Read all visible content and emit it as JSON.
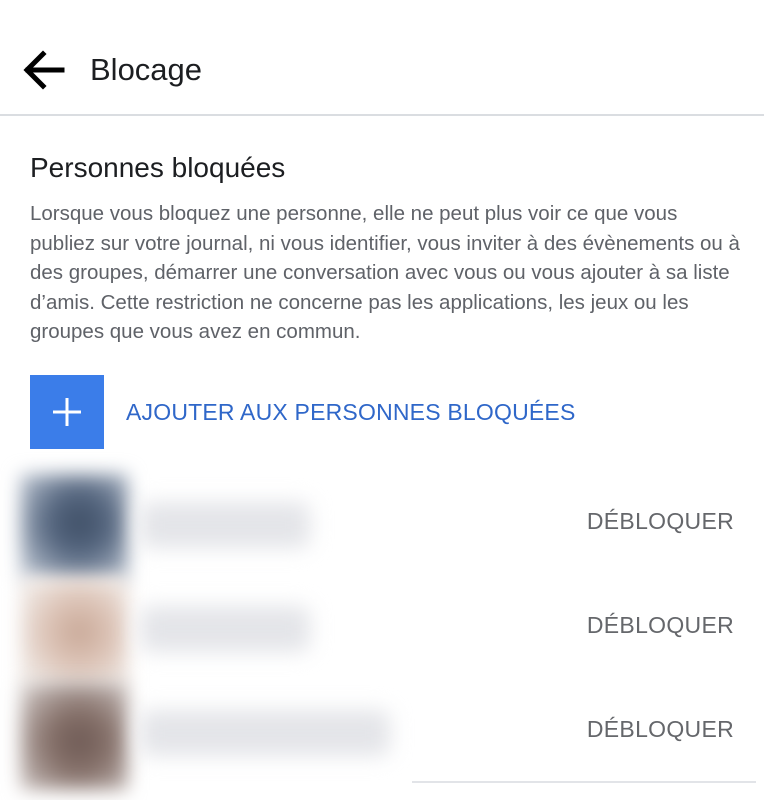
{
  "header": {
    "title": "Blocage",
    "back_icon": "arrow-left-icon"
  },
  "section": {
    "title": "Personnes bloquées",
    "description": "Lorsque vous bloquez une personne, elle ne peut plus voir ce que vous publiez sur votre journal, ni vous identifier, vous inviter à des évènements ou à des groupes, démarrer une conversation avec vous ou vous ajouter à sa liste d’amis. Cette restriction ne concerne pas les applications, les jeux ou les groupes que vous avez en commun."
  },
  "add_button": {
    "label": "AJOUTER AUX PERSONNES BLOQUÉES",
    "icon": "plus-icon"
  },
  "blocked_people": [
    {
      "unblock_label": "DÉBLOQUER"
    },
    {
      "unblock_label": "DÉBLOQUER"
    },
    {
      "unblock_label": "DÉBLOQUER"
    }
  ],
  "colors": {
    "accent": "#3b7de9",
    "link": "#2f67c9",
    "secondary_text": "#65676b",
    "divider": "#dadde1"
  }
}
